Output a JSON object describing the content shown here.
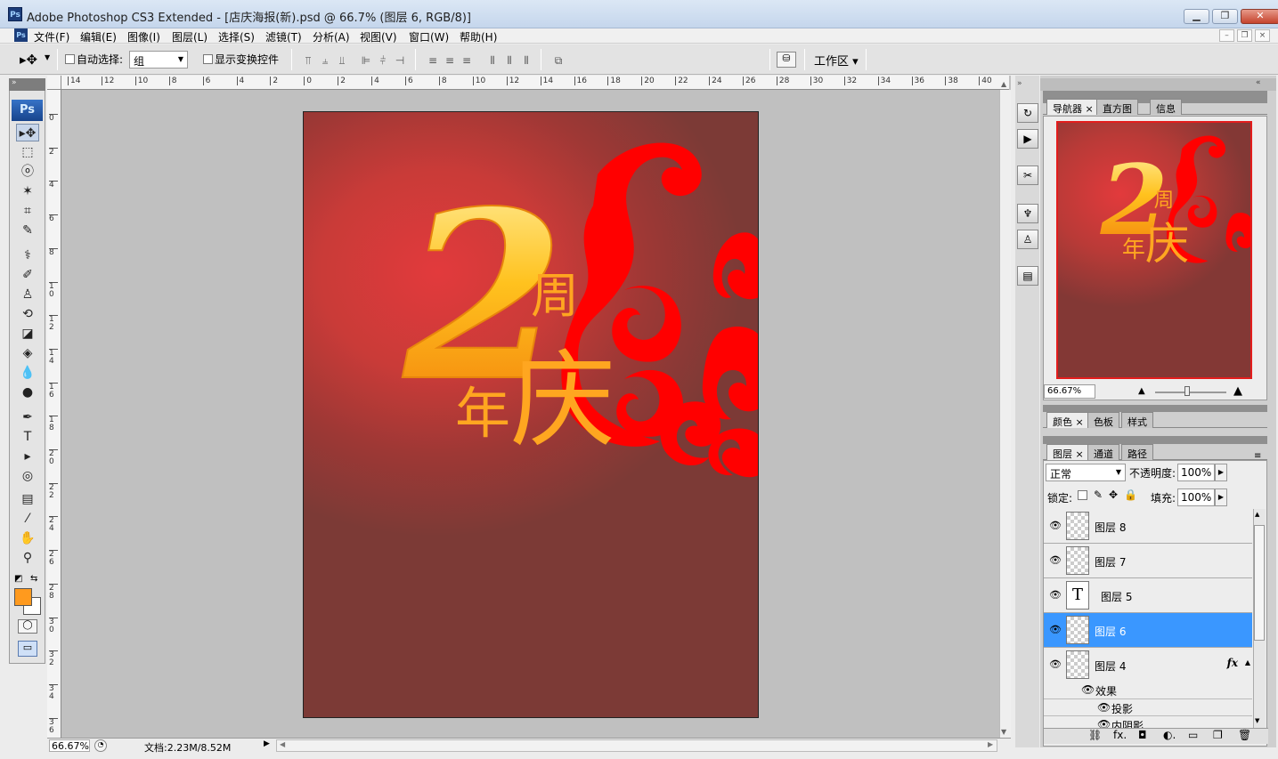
{
  "window": {
    "title": "Adobe Photoshop CS3 Extended - [店庆海报(新).psd @ 66.7% (图层 6, RGB/8)]",
    "app_icon": "Ps",
    "controls": {
      "minimize": "▁",
      "restore": "❐",
      "close": "✕"
    }
  },
  "menu": {
    "items": [
      "文件(F)",
      "编辑(E)",
      "图像(I)",
      "图层(L)",
      "选择(S)",
      "滤镜(T)",
      "分析(A)",
      "视图(V)",
      "窗口(W)",
      "帮助(H)"
    ],
    "doc_controls": {
      "minimize": "–",
      "restore": "❐",
      "close": "×"
    }
  },
  "options": {
    "auto_select_label": "自动选择:",
    "auto_select_value": "组",
    "show_transform_label": "显示变换控件",
    "workspace_label": "工作区 ▾"
  },
  "toolbox": {
    "logo": "Ps",
    "handle": "»",
    "tools": [
      "move-tool",
      "marquee-tool",
      "lasso-tool",
      "magic-wand-tool",
      "crop-tool",
      "slice-tool",
      "healing-brush-tool",
      "brush-tool",
      "clone-stamp-tool",
      "history-brush-tool",
      "eraser-tool",
      "paint-bucket-tool",
      "blur-tool",
      "dodge-tool",
      "pen-tool",
      "type-tool",
      "path-select-tool",
      "shape-tool",
      "notes-tool",
      "eyedropper-tool",
      "hand-tool",
      "zoom-tool"
    ],
    "glyphs": [
      "▸✥",
      "⬚",
      "ⓞ",
      "✶",
      "⌗",
      "✎",
      "⚕",
      "✐",
      "♙",
      "⟲",
      "◪",
      "◈",
      "💧",
      "●",
      "✒",
      "T",
      "▸",
      "◎",
      "▤",
      "⁄",
      "✋",
      "⚲"
    ],
    "foreground_color": "#ff9a1e",
    "background_color": "#ffffff"
  },
  "ruler": {
    "top_labels": [
      "14",
      "12",
      "10",
      "8",
      "6",
      "4",
      "2",
      "0",
      "2",
      "4",
      "6",
      "8",
      "10",
      "12",
      "14",
      "16",
      "18",
      "20",
      "22",
      "24",
      "26",
      "28",
      "30",
      "32",
      "34",
      "36",
      "38",
      "40"
    ],
    "left_labels": [
      "0",
      "2",
      "4",
      "6",
      "8",
      "10",
      "12",
      "14",
      "16",
      "18",
      "20",
      "22",
      "24",
      "26",
      "28",
      "30",
      "32",
      "34",
      "36"
    ]
  },
  "canvas": {
    "numeral": "2",
    "char_zhou": "周",
    "char_nian": "年",
    "char_qing": "庆"
  },
  "status": {
    "zoom": "66.67%",
    "doc_info": "文档:2.23M/8.52M"
  },
  "navigator": {
    "tabs": [
      "导航器",
      "直方图",
      "信息"
    ],
    "zoom": "66.67%"
  },
  "color_panel": {
    "tabs": [
      "颜色",
      "色板",
      "样式"
    ]
  },
  "layers_panel": {
    "tabs": [
      "图层",
      "通道",
      "路径"
    ],
    "blend_mode": "正常",
    "opacity_label": "不透明度:",
    "opacity_value": "100%",
    "lock_label": "锁定:",
    "fill_label": "填充:",
    "fill_value": "100%",
    "layers": [
      {
        "name": "图层 8",
        "type": "pixel",
        "selected": false
      },
      {
        "name": "图层 7",
        "type": "pixel",
        "selected": false
      },
      {
        "name": "图层 5",
        "type": "text",
        "selected": false
      },
      {
        "name": "图层 6",
        "type": "pixel",
        "selected": true
      },
      {
        "name": "图层 4",
        "type": "pixel",
        "selected": false,
        "fx": "fx"
      }
    ],
    "effects_label": "效果",
    "effects": [
      "投影",
      "内阴影"
    ],
    "footer_icons": [
      "link-icon",
      "fx-icon",
      "mask-icon",
      "adjustment-icon",
      "group-icon",
      "new-layer-icon",
      "trash-icon"
    ],
    "footer_glyphs": [
      "⛓",
      "fx.",
      "◘",
      "◐.",
      "▭",
      "❐",
      "🗑"
    ]
  }
}
